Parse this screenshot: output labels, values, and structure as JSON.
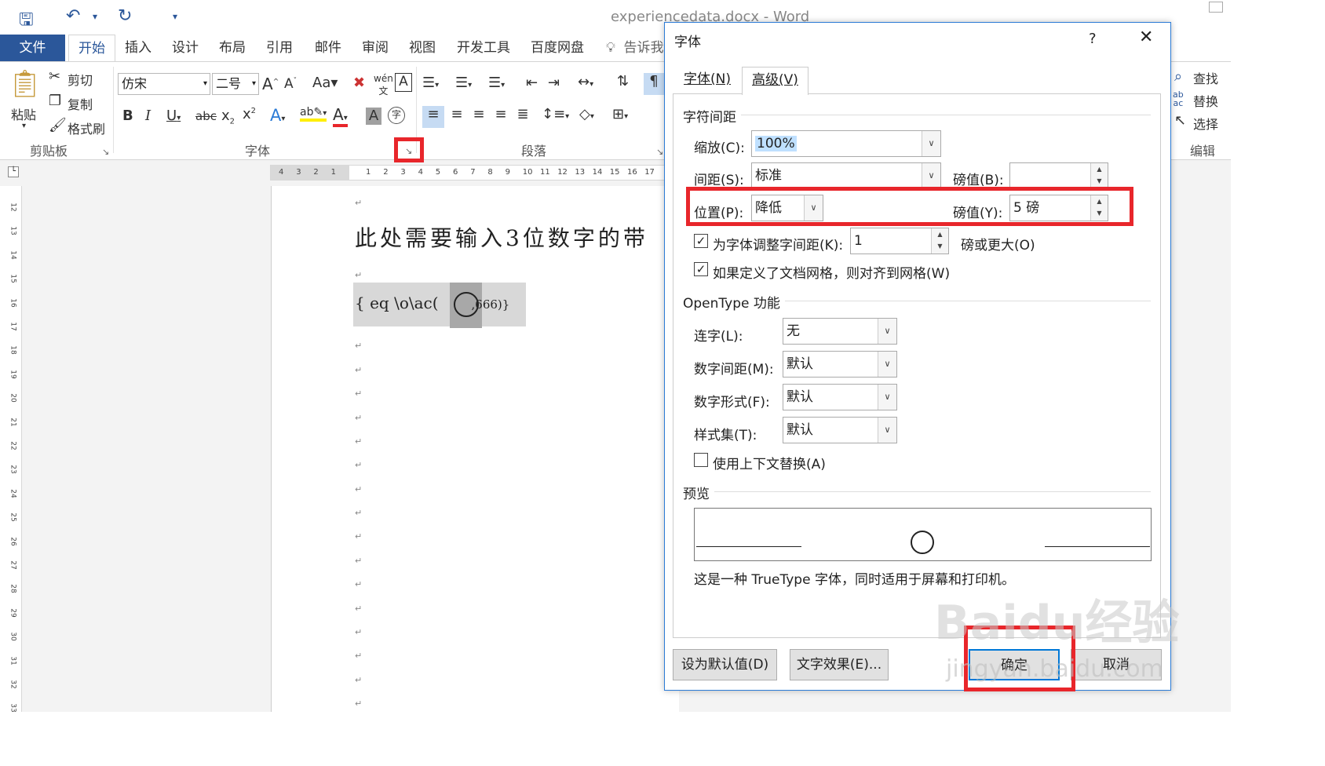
{
  "app": {
    "doc_title": "experiencedata.docx - Word"
  },
  "qat": {
    "save_icon": "save-icon",
    "undo_icon": "undo-icon",
    "redo_icon": "redo-icon",
    "customize_icon": "customize-icon"
  },
  "tabs": {
    "file": "文件",
    "home": "开始",
    "insert": "插入",
    "design": "设计",
    "layout": "布局",
    "references": "引用",
    "mailings": "邮件",
    "review": "审阅",
    "view": "视图",
    "developer": "开发工具",
    "baidu": "百度网盘",
    "tell": "告诉我"
  },
  "ribbon": {
    "clipboard": {
      "paste": "粘贴",
      "cut": "剪切",
      "copy": "复制",
      "format_painter": "格式刷",
      "label": "剪贴板"
    },
    "font": {
      "family": "仿宋",
      "size": "二号",
      "label": "字体"
    },
    "paragraph": {
      "label": "段落"
    },
    "editing": {
      "find": "查找",
      "replace": "替换",
      "select": "选择",
      "label": "编辑"
    }
  },
  "ruler": {
    "h_ticks": [
      "4",
      "3",
      "2",
      "1",
      "",
      "1",
      "2",
      "3",
      "4",
      "5",
      "6",
      "7",
      "8",
      "9",
      "10",
      "11",
      "12",
      "13",
      "14",
      "15",
      "16",
      "17"
    ],
    "v_ticks": [
      "12",
      "13",
      "14",
      "15",
      "16",
      "17",
      "18",
      "19",
      "20",
      "21",
      "22",
      "23",
      "24",
      "25",
      "26",
      "27",
      "28",
      "29",
      "30",
      "31",
      "32",
      "33"
    ]
  },
  "document": {
    "line1": "此处需要输入3位数字的带",
    "field_code_start": "{ eq \\o\\ac(",
    "field_code_end": ",666)}",
    "para_mark": "↵"
  },
  "dialog": {
    "title": "字体",
    "help": "?",
    "close": "✕",
    "tab_font": "字体(N)",
    "tab_advanced": "高级(V)",
    "char_spacing": {
      "section": "字符间距",
      "scale_label": "缩放(C):",
      "scale_value": "100%",
      "spacing_label": "间距(S):",
      "spacing_value": "标准",
      "spacing_pt_label": "磅值(B):",
      "spacing_pt_value": "",
      "position_label": "位置(P):",
      "position_value": "降低",
      "position_pt_label": "磅值(Y):",
      "position_pt_value": "5 磅",
      "kerning_label": "为字体调整字间距(K):",
      "kerning_value": "1",
      "kerning_suffix": "磅或更大(O)",
      "snap_grid_label": "如果定义了文档网格，则对齐到网格(W)"
    },
    "opentype": {
      "section": "OpenType 功能",
      "ligatures_label": "连字(L):",
      "ligatures_value": "无",
      "num_spacing_label": "数字间距(M):",
      "num_spacing_value": "默认",
      "num_forms_label": "数字形式(F):",
      "num_forms_value": "默认",
      "stylistic_label": "样式集(T):",
      "stylistic_value": "默认",
      "contextual_label": "使用上下文替换(A)"
    },
    "preview": {
      "section": "预览",
      "note": "这是一种 TrueType 字体，同时适用于屏幕和打印机。"
    },
    "buttons": {
      "set_default": "设为默认值(D)",
      "text_effects": "文字效果(E)...",
      "ok": "确定",
      "cancel": "取消"
    }
  },
  "watermark": {
    "brand": "Baidu经验",
    "url": "jingyan.baidu.com"
  },
  "colors": {
    "accent": "#2b579a",
    "highlight": "#e8262b"
  }
}
